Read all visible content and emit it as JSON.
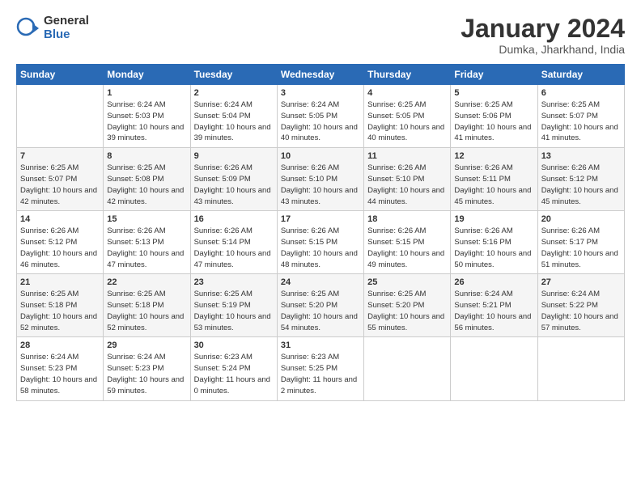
{
  "header": {
    "logo_general": "General",
    "logo_blue": "Blue",
    "month": "January 2024",
    "location": "Dumka, Jharkhand, India"
  },
  "weekdays": [
    "Sunday",
    "Monday",
    "Tuesday",
    "Wednesday",
    "Thursday",
    "Friday",
    "Saturday"
  ],
  "weeks": [
    [
      {
        "day": "",
        "info": ""
      },
      {
        "day": "1",
        "info": "Sunrise: 6:24 AM\nSunset: 5:03 PM\nDaylight: 10 hours\nand 39 minutes."
      },
      {
        "day": "2",
        "info": "Sunrise: 6:24 AM\nSunset: 5:04 PM\nDaylight: 10 hours\nand 39 minutes."
      },
      {
        "day": "3",
        "info": "Sunrise: 6:24 AM\nSunset: 5:05 PM\nDaylight: 10 hours\nand 40 minutes."
      },
      {
        "day": "4",
        "info": "Sunrise: 6:25 AM\nSunset: 5:05 PM\nDaylight: 10 hours\nand 40 minutes."
      },
      {
        "day": "5",
        "info": "Sunrise: 6:25 AM\nSunset: 5:06 PM\nDaylight: 10 hours\nand 41 minutes."
      },
      {
        "day": "6",
        "info": "Sunrise: 6:25 AM\nSunset: 5:07 PM\nDaylight: 10 hours\nand 41 minutes."
      }
    ],
    [
      {
        "day": "7",
        "info": "Sunrise: 6:25 AM\nSunset: 5:07 PM\nDaylight: 10 hours\nand 42 minutes."
      },
      {
        "day": "8",
        "info": "Sunrise: 6:25 AM\nSunset: 5:08 PM\nDaylight: 10 hours\nand 42 minutes."
      },
      {
        "day": "9",
        "info": "Sunrise: 6:26 AM\nSunset: 5:09 PM\nDaylight: 10 hours\nand 43 minutes."
      },
      {
        "day": "10",
        "info": "Sunrise: 6:26 AM\nSunset: 5:10 PM\nDaylight: 10 hours\nand 43 minutes."
      },
      {
        "day": "11",
        "info": "Sunrise: 6:26 AM\nSunset: 5:10 PM\nDaylight: 10 hours\nand 44 minutes."
      },
      {
        "day": "12",
        "info": "Sunrise: 6:26 AM\nSunset: 5:11 PM\nDaylight: 10 hours\nand 45 minutes."
      },
      {
        "day": "13",
        "info": "Sunrise: 6:26 AM\nSunset: 5:12 PM\nDaylight: 10 hours\nand 45 minutes."
      }
    ],
    [
      {
        "day": "14",
        "info": "Sunrise: 6:26 AM\nSunset: 5:12 PM\nDaylight: 10 hours\nand 46 minutes."
      },
      {
        "day": "15",
        "info": "Sunrise: 6:26 AM\nSunset: 5:13 PM\nDaylight: 10 hours\nand 47 minutes."
      },
      {
        "day": "16",
        "info": "Sunrise: 6:26 AM\nSunset: 5:14 PM\nDaylight: 10 hours\nand 47 minutes."
      },
      {
        "day": "17",
        "info": "Sunrise: 6:26 AM\nSunset: 5:15 PM\nDaylight: 10 hours\nand 48 minutes."
      },
      {
        "day": "18",
        "info": "Sunrise: 6:26 AM\nSunset: 5:15 PM\nDaylight: 10 hours\nand 49 minutes."
      },
      {
        "day": "19",
        "info": "Sunrise: 6:26 AM\nSunset: 5:16 PM\nDaylight: 10 hours\nand 50 minutes."
      },
      {
        "day": "20",
        "info": "Sunrise: 6:26 AM\nSunset: 5:17 PM\nDaylight: 10 hours\nand 51 minutes."
      }
    ],
    [
      {
        "day": "21",
        "info": "Sunrise: 6:25 AM\nSunset: 5:18 PM\nDaylight: 10 hours\nand 52 minutes."
      },
      {
        "day": "22",
        "info": "Sunrise: 6:25 AM\nSunset: 5:18 PM\nDaylight: 10 hours\nand 52 minutes."
      },
      {
        "day": "23",
        "info": "Sunrise: 6:25 AM\nSunset: 5:19 PM\nDaylight: 10 hours\nand 53 minutes."
      },
      {
        "day": "24",
        "info": "Sunrise: 6:25 AM\nSunset: 5:20 PM\nDaylight: 10 hours\nand 54 minutes."
      },
      {
        "day": "25",
        "info": "Sunrise: 6:25 AM\nSunset: 5:20 PM\nDaylight: 10 hours\nand 55 minutes."
      },
      {
        "day": "26",
        "info": "Sunrise: 6:24 AM\nSunset: 5:21 PM\nDaylight: 10 hours\nand 56 minutes."
      },
      {
        "day": "27",
        "info": "Sunrise: 6:24 AM\nSunset: 5:22 PM\nDaylight: 10 hours\nand 57 minutes."
      }
    ],
    [
      {
        "day": "28",
        "info": "Sunrise: 6:24 AM\nSunset: 5:23 PM\nDaylight: 10 hours\nand 58 minutes."
      },
      {
        "day": "29",
        "info": "Sunrise: 6:24 AM\nSunset: 5:23 PM\nDaylight: 10 hours\nand 59 minutes."
      },
      {
        "day": "30",
        "info": "Sunrise: 6:23 AM\nSunset: 5:24 PM\nDaylight: 11 hours\nand 0 minutes."
      },
      {
        "day": "31",
        "info": "Sunrise: 6:23 AM\nSunset: 5:25 PM\nDaylight: 11 hours\nand 2 minutes."
      },
      {
        "day": "",
        "info": ""
      },
      {
        "day": "",
        "info": ""
      },
      {
        "day": "",
        "info": ""
      }
    ]
  ]
}
